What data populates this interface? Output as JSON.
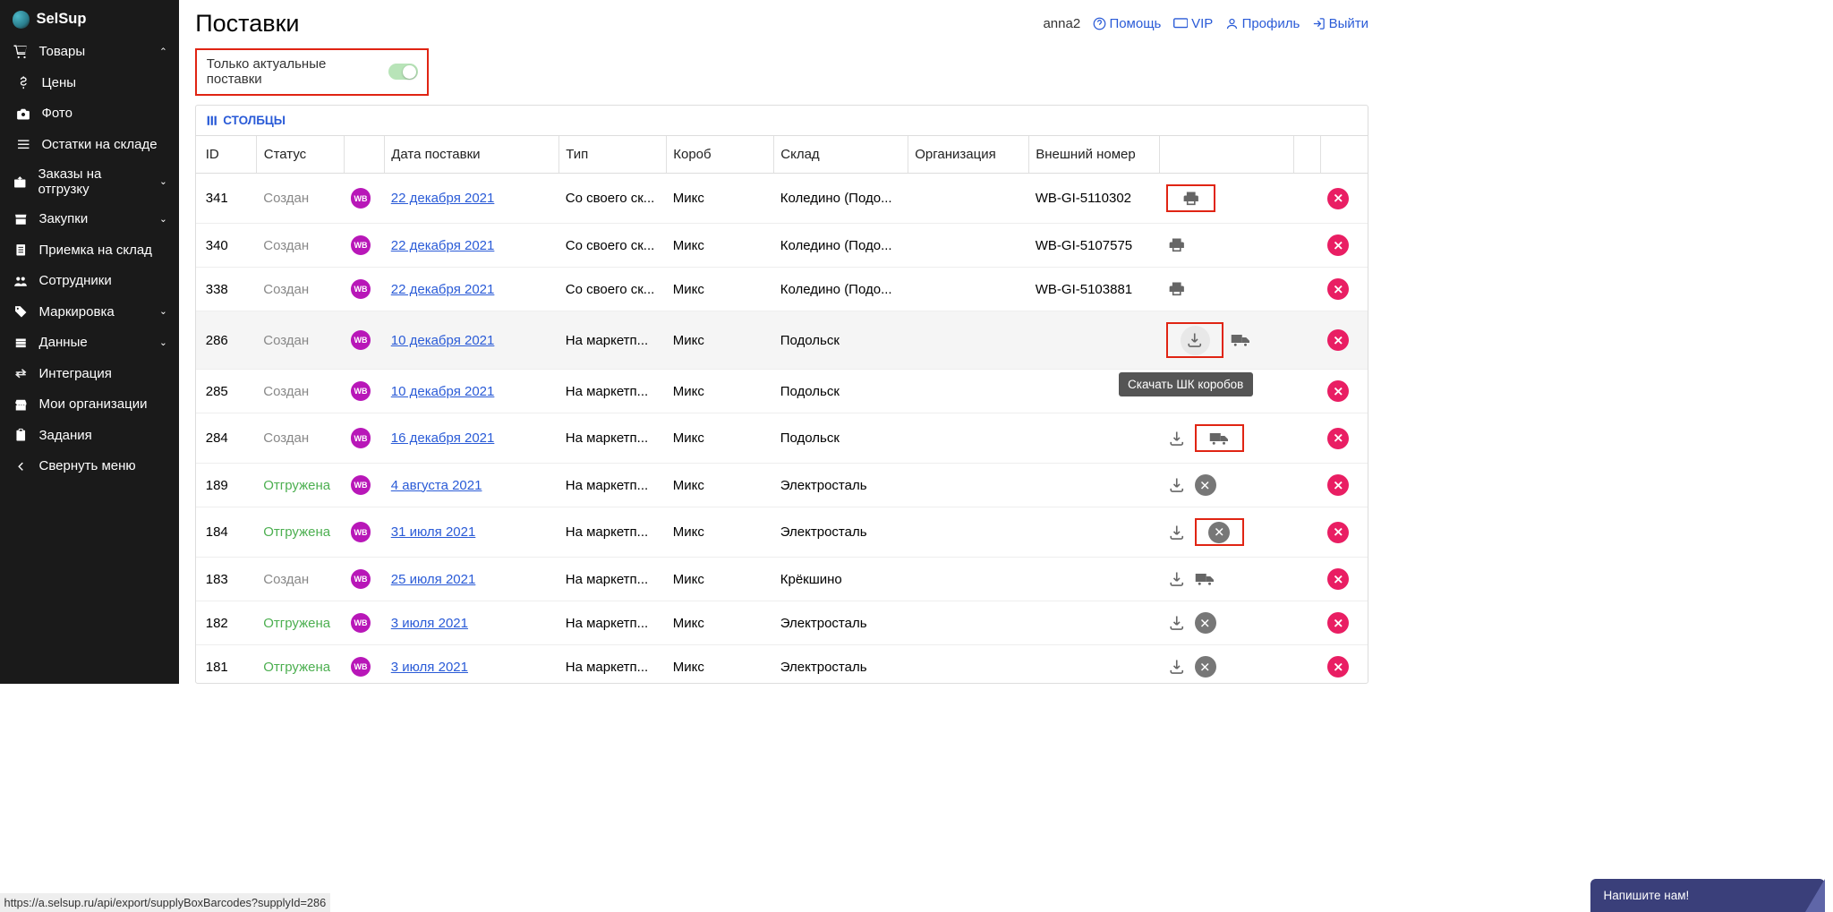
{
  "brand": "SelSup",
  "sidebar": [
    {
      "icon": "cart",
      "label": "Товары",
      "chev": "up",
      "sub": [
        {
          "icon": "dollar",
          "label": "Цены"
        },
        {
          "icon": "camera",
          "label": "Фото"
        },
        {
          "icon": "list",
          "label": "Остатки на складе"
        }
      ]
    },
    {
      "icon": "export-box",
      "label": "Заказы на отгрузку",
      "chev": "down"
    },
    {
      "icon": "store",
      "label": "Закупки",
      "chev": "down"
    },
    {
      "icon": "receipt",
      "label": "Приемка на склад"
    },
    {
      "icon": "people",
      "label": "Сотрудники"
    },
    {
      "icon": "tag",
      "label": "Маркировка",
      "chev": "down"
    },
    {
      "icon": "db",
      "label": "Данные",
      "chev": "down"
    },
    {
      "icon": "swap",
      "label": "Интеграция"
    },
    {
      "icon": "org",
      "label": "Мои организации"
    },
    {
      "icon": "clipboard",
      "label": "Задания"
    },
    {
      "icon": "collapse",
      "label": "Свернуть меню"
    }
  ],
  "header": {
    "title": "Поставки",
    "user": "anna2",
    "links": {
      "help": "Помощь",
      "vip": "VIP",
      "profile": "Профиль",
      "logout": "Выйти"
    }
  },
  "toggle": {
    "label": "Только актуальные поставки",
    "on": true
  },
  "columns_btn": "СТОЛБЦЫ",
  "table": {
    "headers": [
      "ID",
      "Статус",
      "",
      "Дата поставки",
      "Тип",
      "Короб",
      "Склад",
      "Организация",
      "Внешний номер",
      "",
      "",
      ""
    ],
    "rows": [
      {
        "id": "341",
        "status": "Создан",
        "st": "gray",
        "date": "22 декабря 2021",
        "type": "Со своего ск...",
        "box": "Микс",
        "stock": "Коледино (Подо...",
        "org": "",
        "ext": "WB-GI-5110302",
        "acts": [
          "print-red"
        ],
        "hov": false
      },
      {
        "id": "340",
        "status": "Создан",
        "st": "gray",
        "date": "22 декабря 2021",
        "type": "Со своего ск...",
        "box": "Микс",
        "stock": "Коледино (Подо...",
        "org": "",
        "ext": "WB-GI-5107575",
        "acts": [
          "print"
        ],
        "hov": false
      },
      {
        "id": "338",
        "status": "Создан",
        "st": "gray",
        "date": "22 декабря 2021",
        "type": "Со своего ск...",
        "box": "Микс",
        "stock": "Коледино (Подо...",
        "org": "",
        "ext": "WB-GI-5103881",
        "acts": [
          "print"
        ],
        "hov": false
      },
      {
        "id": "286",
        "status": "Создан",
        "st": "gray",
        "date": "10 декабря 2021",
        "type": "На маркетп...",
        "box": "Микс",
        "stock": "Подольск",
        "org": "",
        "ext": "",
        "acts": [
          "download-red-hov",
          "truck"
        ],
        "hov": true
      },
      {
        "id": "285",
        "status": "Создан",
        "st": "gray",
        "date": "10 декабря 2021",
        "type": "На маркетп...",
        "box": "Микс",
        "stock": "Подольск",
        "org": "",
        "ext": "",
        "acts": [
          "tooltip"
        ],
        "hov": false
      },
      {
        "id": "284",
        "status": "Создан",
        "st": "gray",
        "date": "16 декабря 2021",
        "type": "На маркетп...",
        "box": "Микс",
        "stock": "Подольск",
        "org": "",
        "ext": "",
        "acts": [
          "download",
          "truck-red"
        ],
        "hov": false
      },
      {
        "id": "189",
        "status": "Отгружена",
        "st": "green",
        "date": "4 августа 2021",
        "type": "На маркетп...",
        "box": "Микс",
        "stock": "Электросталь",
        "org": "",
        "ext": "",
        "acts": [
          "download",
          "gray-x"
        ],
        "hov": false
      },
      {
        "id": "184",
        "status": "Отгружена",
        "st": "green",
        "date": "31 июля 2021",
        "type": "На маркетп...",
        "box": "Микс",
        "stock": "Электросталь",
        "org": "",
        "ext": "",
        "acts": [
          "download",
          "gray-x-red"
        ],
        "hov": false
      },
      {
        "id": "183",
        "status": "Создан",
        "st": "gray",
        "date": "25 июля 2021",
        "type": "На маркетп...",
        "box": "Микс",
        "stock": "Крёкшино",
        "org": "",
        "ext": "",
        "acts": [
          "download",
          "truck"
        ],
        "hov": false
      },
      {
        "id": "182",
        "status": "Отгружена",
        "st": "green",
        "date": "3 июля 2021",
        "type": "На маркетп...",
        "box": "Микс",
        "stock": "Электросталь",
        "org": "",
        "ext": "",
        "acts": [
          "download",
          "gray-x"
        ],
        "hov": false
      },
      {
        "id": "181",
        "status": "Отгружена",
        "st": "green",
        "date": "3 июля 2021",
        "type": "На маркетп...",
        "box": "Микс",
        "stock": "Электросталь",
        "org": "",
        "ext": "",
        "acts": [
          "download",
          "gray-x"
        ],
        "hov": false
      }
    ]
  },
  "tooltip": "Скачать ШК коробов",
  "chat": "Напишите нам!",
  "status_url": "https://a.selsup.ru/api/export/supplyBoxBarcodes?supplyId=286",
  "mp_badge": "WB"
}
